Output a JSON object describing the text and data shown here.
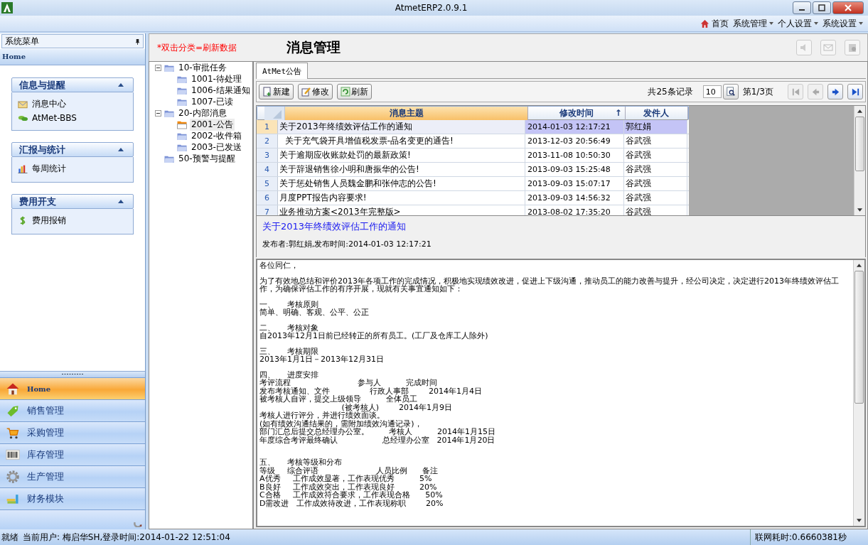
{
  "window": {
    "title": "AtmetERP2.0.9.1"
  },
  "top_menu": [
    {
      "label": "首页",
      "kind": "home"
    },
    {
      "label": "系统管理",
      "kind": "dropdown"
    },
    {
      "label": "个人设置",
      "kind": "dropdown"
    },
    {
      "label": "系统设置",
      "kind": "dropdown"
    }
  ],
  "sidebar": {
    "title": "系统菜单",
    "home_label": "Home",
    "groups": [
      {
        "title": "信息与提醒",
        "expanded": true,
        "items": [
          {
            "label": "消息中心",
            "kind": "mail"
          },
          {
            "label": "AtMet-BBS",
            "kind": "chat"
          }
        ]
      },
      {
        "title": "汇报与统计",
        "expanded": true,
        "items": [
          {
            "label": "每周统计",
            "kind": "chart"
          }
        ]
      },
      {
        "title": "费用开支",
        "expanded": true,
        "items": [
          {
            "label": "费用报销",
            "kind": "dollar"
          }
        ]
      }
    ],
    "nav": [
      {
        "label": "Home",
        "kind": "home",
        "selected": true
      },
      {
        "label": "销售管理",
        "kind": "tag",
        "selected": false
      },
      {
        "label": "采购管理",
        "kind": "cart",
        "selected": false
      },
      {
        "label": "库存管理",
        "kind": "barcode",
        "selected": false
      },
      {
        "label": "生产管理",
        "kind": "gear",
        "selected": false
      },
      {
        "label": "财务模块",
        "kind": "books",
        "selected": false
      }
    ]
  },
  "header": {
    "hint": "*双击分类=刷新数据",
    "title": "消息管理"
  },
  "tree": [
    {
      "label": "10-审批任务",
      "expanded": true,
      "selected": false,
      "children": [
        {
          "label": "1001-待处理",
          "selected": false
        },
        {
          "label": "1006-结果通知",
          "selected": false
        },
        {
          "label": "1007-已读",
          "selected": false
        }
      ]
    },
    {
      "label": "20-内部消息",
      "expanded": true,
      "selected": false,
      "children": [
        {
          "label": "2001-公告",
          "selected": true
        },
        {
          "label": "2002-收件箱",
          "selected": false
        },
        {
          "label": "2003-已发送",
          "selected": false
        }
      ]
    },
    {
      "label": "50-预警与提醒",
      "selected": false
    }
  ],
  "tabs": [
    {
      "label": "AtMet公告",
      "selected": true
    }
  ],
  "toolbar": {
    "buttons": [
      {
        "label": "新建",
        "kind": "new"
      },
      {
        "label": "修改",
        "kind": "edit"
      },
      {
        "label": "刷新",
        "kind": "refresh"
      }
    ],
    "record_count": "共25条记录",
    "page_size": "10",
    "page_info": "第1/3页",
    "nav": [
      {
        "kind": "first",
        "disabled": true
      },
      {
        "kind": "prev",
        "disabled": true
      },
      {
        "kind": "next",
        "disabled": false
      },
      {
        "kind": "last",
        "disabled": false
      }
    ]
  },
  "table": {
    "columns": [
      {
        "label": "消息主题"
      },
      {
        "label": "修改时间",
        "sort": "↑"
      },
      {
        "label": "发件人"
      }
    ],
    "rows": [
      {
        "num": "1",
        "subject": "关于2013年终绩效评估工作的通知",
        "time": "2014-01-03 12:17:21",
        "sender": "郭红娟",
        "selected": true
      },
      {
        "num": "2",
        "subject": "  关于充气袋开具增值税发票-品名变更的通告!",
        "time": "2013-12-03 20:56:49",
        "sender": "谷武强",
        "selected": false
      },
      {
        "num": "3",
        "subject": "关于逾期应收账款处罚的最新政策!",
        "time": "2013-11-08 10:50:30",
        "sender": "谷武强",
        "selected": false
      },
      {
        "num": "4",
        "subject": "关于辞退销售徐小明和唐振华的公告!",
        "time": "2013-09-03 15:25:48",
        "sender": "谷武强",
        "selected": false
      },
      {
        "num": "5",
        "subject": "关于惩处销售人员魏金鹏和张仲志的公告!",
        "time": "2013-09-03 15:07:17",
        "sender": "谷武强",
        "selected": false
      },
      {
        "num": "6",
        "subject": "月度PPT报告内容要求!",
        "time": "2013-09-03 14:56:32",
        "sender": "谷武强",
        "selected": false
      },
      {
        "num": "7",
        "subject": "业务推动方案<2013年完整版>",
        "time": "2013-08-02 17:35:20",
        "sender": "谷武强",
        "selected": false
      }
    ]
  },
  "detail": {
    "title": "关于2013年终绩效评估工作的通知",
    "meta": "发布者:郭红娟,发布时间:2014-01-03 12:17:21"
  },
  "body": [
    [
      "各位同仁，"
    ],
    [
      "为了有效地总结和评价2013年各项工作的完成情况，积极地实现绩效改进，促进上下级沟通，推动员工的能力改善与提升，经公司决定，决定进行2013年终绩效评估工作，为确保评估工作的有序开展，现就有关事宜通知如下："
    ],
    [
      "一、     考核原则",
      "简单、明确、客观、公平、公正"
    ],
    [
      "二、     考核对象",
      "自2013年12月1日前已经转正的所有员工。(工厂及仓库工人除外)"
    ],
    [
      "三、     考核期限",
      "2013年1月1日－2013年12月31日"
    ],
    [
      "四、     进度安排",
      "考评流程                           参与人          完成时间",
      "发布考核通知、文件                行政人事部        2014年1月4日",
      "被考核人自评，提交上级领导          全体员工",
      "                                 (被考核人)        2014年1月9日",
      "考核人进行评分，并进行绩效面谈。",
      "(如有绩效沟通结果的，需附加绩效沟通记录)，",
      "部门汇总后提交总经理办公室。        考核人          2014年1月15日",
      "年度综合考评最终确认                  总经理办公室   2014年1月20日"
    ],
    [
      "五、     考核等级和分布",
      "等级     综合评语                       人员比例      备注",
      "A优秀     工作成效显著，工作表现优秀          5%",
      "B良好     工作成效突出，工作表现良好          20%",
      "C合格     工作成效符合要求，工作表现合格      50%",
      "D需改进   工作成效待改进，工作表现称职        20%"
    ]
  ],
  "status_bar": {
    "ready": "就绪",
    "user": "当前用户: 梅启华SH,登录时间:2014-01-22 12:51:04",
    "latency": "联网耗时:0.6660381秒"
  }
}
